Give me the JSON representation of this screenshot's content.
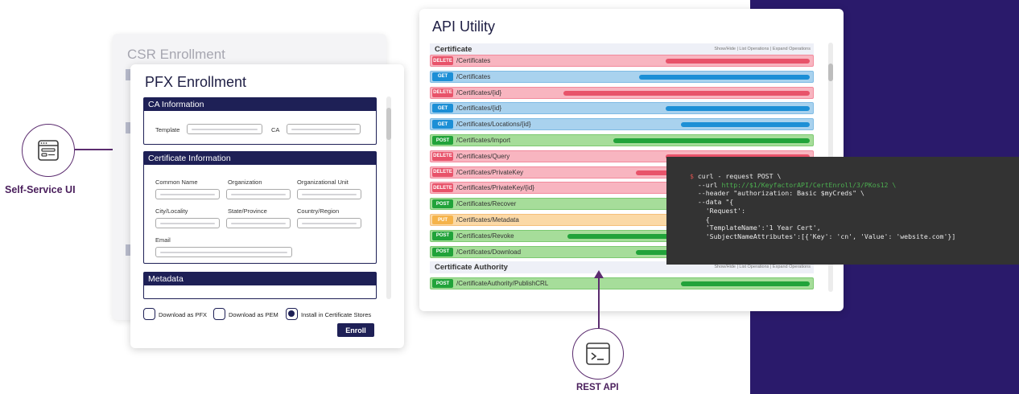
{
  "left_node": {
    "label": "Self-Service UI",
    "icon": "browser-form-icon"
  },
  "csr_card": {
    "title": "CSR Enrollment"
  },
  "pfx_card": {
    "title": "PFX Enrollment",
    "ca_section": {
      "header": "CA Information",
      "template_label": "Template",
      "ca_label": "CA"
    },
    "cert_section": {
      "header": "Certificate Information",
      "common_name": "Common Name",
      "organization": "Organization",
      "org_unit": "Organizational Unit",
      "city": "City/Locality",
      "state": "State/Province",
      "country": "Country/Region",
      "email": "Email"
    },
    "metadata_section": {
      "header": "Metadata"
    },
    "options": [
      {
        "label": "Download as PFX",
        "checked": false
      },
      {
        "label": "Download as PEM",
        "checked": false
      },
      {
        "label": "Install in Certificate Stores",
        "checked": true
      }
    ],
    "enroll_label": "Enroll"
  },
  "api_card": {
    "title": "API Utility",
    "method_colors": {
      "DELETE": "#e8536a",
      "GET": "#1c8fd6",
      "POST": "#21a33a",
      "PUT": "#f5b34a"
    },
    "groups": [
      {
        "name": "Certificate",
        "ops": "Show/Hide | List Operations | Expand Operations",
        "endpoints": [
          {
            "method": "DELETE",
            "path": "/Certificates",
            "fill": 0.38
          },
          {
            "method": "GET",
            "path": "/Certificates",
            "fill": 0.45
          },
          {
            "method": "DELETE",
            "path": "/Certificates/{id}",
            "fill": 0.65
          },
          {
            "method": "GET",
            "path": "/Certificates/{id}",
            "fill": 0.38
          },
          {
            "method": "GET",
            "path": "/Certificates/Locations/{id}",
            "fill": 0.34
          },
          {
            "method": "POST",
            "path": "/Certificates/Import",
            "fill": 0.52
          },
          {
            "method": "DELETE",
            "path": "/Certificates/Query",
            "fill": 0.38
          },
          {
            "method": "DELETE",
            "path": "/Certificates/PrivateKey",
            "fill": 0.46
          },
          {
            "method": "DELETE",
            "path": "/Certificates/PrivateKey/{id}",
            "fill": 0.36
          },
          {
            "method": "POST",
            "path": "/Certificates/Recover",
            "fill": 0.36
          },
          {
            "method": "PUT",
            "path": "/Certificates/Metadata",
            "fill": 0.34
          },
          {
            "method": "POST",
            "path": "/Certificates/Revoke",
            "fill": 0.64
          },
          {
            "method": "POST",
            "path": "/Certificates/Download",
            "fill": 0.46
          }
        ]
      },
      {
        "name": "Certificate Authority",
        "ops": "Show/Hide | List Operations | Expand Operations",
        "endpoints": [
          {
            "method": "POST",
            "path": "/CertificateAuthority/PublishCRL",
            "fill": 0.34
          }
        ]
      }
    ]
  },
  "terminal": {
    "prompt": "$",
    "l1": "curl - request POST \\",
    "l2_key": "--url",
    "l2_url": "http://$1/KeyfactorAPI/CertEnroll/3/PKos12 \\",
    "l3": "--header \"authorization: Basic $myCreds\" \\",
    "l4": "--data \"{",
    "l5": "'Request':",
    "l6": "{",
    "l7": "'TemplateName':'1 Year Cert',",
    "l8": "'SubjectNameAttributes':[{'Key': 'cn', 'Value': 'website.com'}]"
  },
  "bottom_node": {
    "label": "REST API",
    "icon": "terminal-prompt-icon"
  }
}
